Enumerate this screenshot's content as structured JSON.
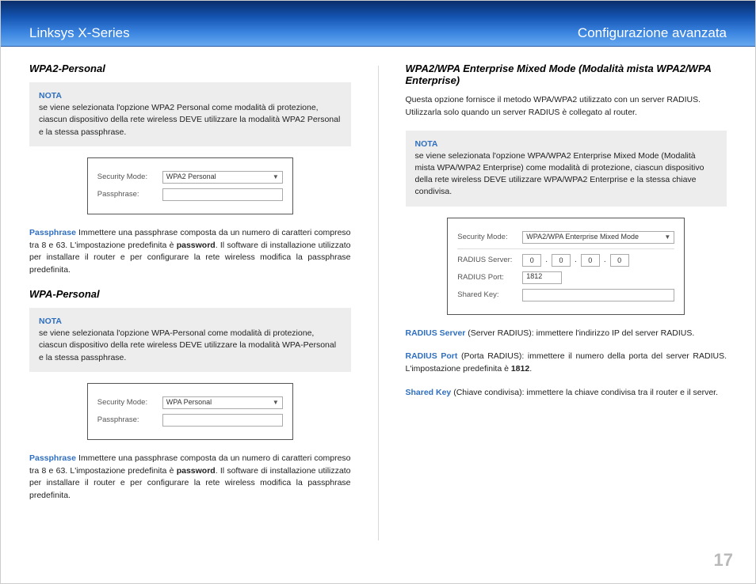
{
  "header": {
    "product": "Linksys X-Series",
    "section": "Configurazione avanzata"
  },
  "page_number": "17",
  "left": {
    "wpa2p": {
      "title": "WPA2-Personal",
      "note_label": "NOTA",
      "note_text": "se viene selezionata l'opzione WPA2 Personal come modalità di protezione, ciascun dispositivo della rete wireless DEVE utilizzare la modalità WPA2 Personal e la stessa passphrase.",
      "form": {
        "security_label": "Security Mode:",
        "security_value": "WPA2 Personal",
        "passphrase_label": "Passphrase:",
        "passphrase_value": ""
      },
      "para_kw": "Passphrase",
      "para_rest_a": "  Immettere una passphrase composta da un numero di caratteri compreso tra 8 e 63. L'impostazione predefinita è ",
      "para_bold": "password",
      "para_rest_b": ". Il software di installazione utilizzato per installare il router e per configurare la rete wireless modifica la passphrase predefinita."
    },
    "wpap": {
      "title": "WPA-Personal",
      "note_label": "NOTA",
      "note_text": "se viene selezionata l'opzione WPA-Personal come modalità di protezione, ciascun dispositivo della rete wireless DEVE utilizzare la modalità WPA-Personal e la stessa passphrase.",
      "form": {
        "security_label": "Security Mode:",
        "security_value": "WPA Personal",
        "passphrase_label": "Passphrase:",
        "passphrase_value": ""
      },
      "para_kw": "Passphrase",
      "para_rest_a": "  Immettere una passphrase composta da un numero di caratteri compreso tra 8 e 63. L'impostazione predefinita è ",
      "para_bold": "password",
      "para_rest_b": ". Il software di installazione utilizzato per installare il router e per configurare la rete wireless modifica la passphrase predefinita."
    }
  },
  "right": {
    "mixed": {
      "title": "WPA2/WPA Enterprise Mixed Mode (Modalità mista WPA2/WPA Enterprise)",
      "intro": "Questa opzione fornisce il metodo WPA/WPA2 utilizzato con un server RADIUS. Utilizzarla solo quando un server RADIUS è collegato al router.",
      "note_label": "NOTA",
      "note_text": "se viene selezionata l'opzione WPA/WPA2 Enterprise Mixed Mode (Modalità mista WPA/WPA2 Enterprise) come modalità di protezione, ciascun dispositivo della rete wireless DEVE utilizzare WPA/WPA2 Enterprise e la stessa chiave condivisa.",
      "form": {
        "security_label": "Security Mode:",
        "security_value": "WPA2/WPA Enterprise Mixed Mode",
        "radius_server_label": "RADIUS Server:",
        "radius_server_oct": [
          "0",
          "0",
          "0",
          "0"
        ],
        "radius_port_label": "RADIUS Port:",
        "radius_port_value": "1812",
        "shared_key_label": "Shared Key:",
        "shared_key_value": ""
      },
      "p1_kw": "RADIUS Server",
      "p1_rest": " (Server RADIUS): immettere l'indirizzo IP del server RADIUS.",
      "p2_kw": "RADIUS Port",
      "p2_rest_a": " (Porta RADIUS): immettere il numero della porta del server RADIUS. L'impostazione predefinita è ",
      "p2_bold": "1812",
      "p2_rest_b": ".",
      "p3_kw": "Shared Key",
      "p3_rest": " (Chiave condivisa): immettere la chiave condivisa tra il router e il server."
    }
  }
}
